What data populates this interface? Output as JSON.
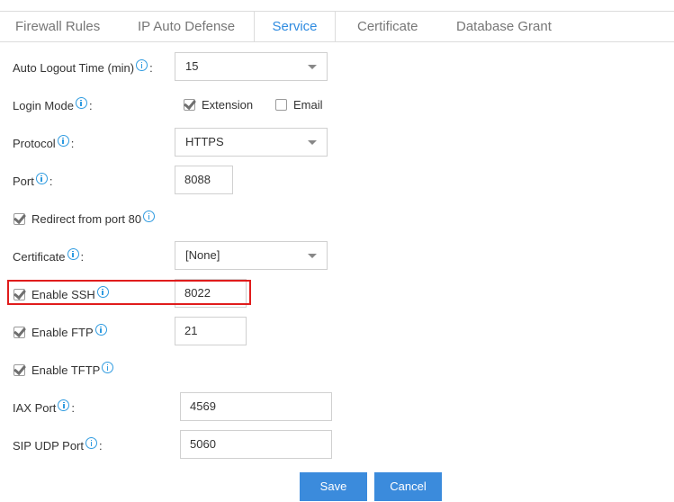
{
  "tabs": [
    {
      "label": "Firewall Rules",
      "active": false
    },
    {
      "label": "IP Auto Defense",
      "active": false
    },
    {
      "label": "Service",
      "active": true
    },
    {
      "label": "Certificate",
      "active": false
    },
    {
      "label": "Database Grant",
      "active": false
    }
  ],
  "form": {
    "auto_logout": {
      "label": "Auto Logout Time (min)",
      "value": "15",
      "icon": "info-icon"
    },
    "login_mode": {
      "label": "Login Mode",
      "options": [
        {
          "label": "Extension",
          "checked": true
        },
        {
          "label": "Email",
          "checked": false
        }
      ]
    },
    "protocol": {
      "label": "Protocol",
      "value": "HTTPS"
    },
    "port": {
      "label": "Port",
      "value": "8088"
    },
    "redirect": {
      "label": "Redirect from port 80",
      "checked": true
    },
    "certificate": {
      "label": "Certificate",
      "value": "[None]"
    },
    "ssh": {
      "label": "Enable SSH",
      "checked": true,
      "value": "8022",
      "highlighted": true
    },
    "ftp": {
      "label": "Enable FTP",
      "checked": true,
      "value": "21"
    },
    "tftp": {
      "label": "Enable TFTP",
      "checked": true
    },
    "iax_port": {
      "label": "IAX Port",
      "value": "4569"
    },
    "sip_udp_port": {
      "label": "SIP UDP Port",
      "value": "5060"
    },
    "colon": ":"
  },
  "buttons": {
    "save": "Save",
    "cancel": "Cancel"
  },
  "colors": {
    "accent": "#3b8bdc",
    "active_tab": "#2f8be0",
    "highlight": "#e01c1c",
    "info_icon": "#2f9be0"
  }
}
